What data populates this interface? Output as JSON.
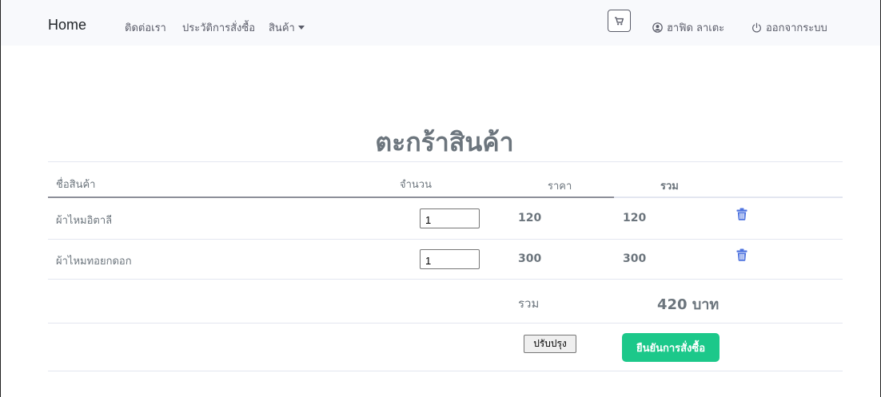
{
  "navbar": {
    "brand": "Home",
    "links": [
      "ติดต่อเรา",
      "ประวัติการสั่งซื้อ",
      "สินค้า"
    ],
    "user_name": "ฮาฟิด ลาเตะ",
    "logout": "ออกจากระบบ"
  },
  "page": {
    "title": "ตะกร้าสินค้า"
  },
  "table": {
    "headers": {
      "name": "ชื่อสินค้า",
      "qty": "จำนวน",
      "price": "ราคา",
      "total": "รวม"
    },
    "rows": [
      {
        "name": "ผ้าไหมอิตาลี",
        "qty": "1",
        "price": "120",
        "total": "120"
      },
      {
        "name": "ผ้าไหมทอยกดอก",
        "qty": "1",
        "price": "300",
        "total": "300"
      }
    ],
    "summary_label": "รวม",
    "summary_total": "420 บาท"
  },
  "actions": {
    "update": "ปรับปรุง",
    "confirm": "ยืนยันการสั่งซื้อ"
  },
  "colors": {
    "navbar_bg": "#f8f9fc",
    "confirm_bg": "#1cc88a",
    "icon_blue": "#4e73df",
    "text_gray": "#6c757d"
  },
  "icons": [
    "cart-icon",
    "user-circle-icon",
    "power-icon",
    "trash-icon"
  ]
}
